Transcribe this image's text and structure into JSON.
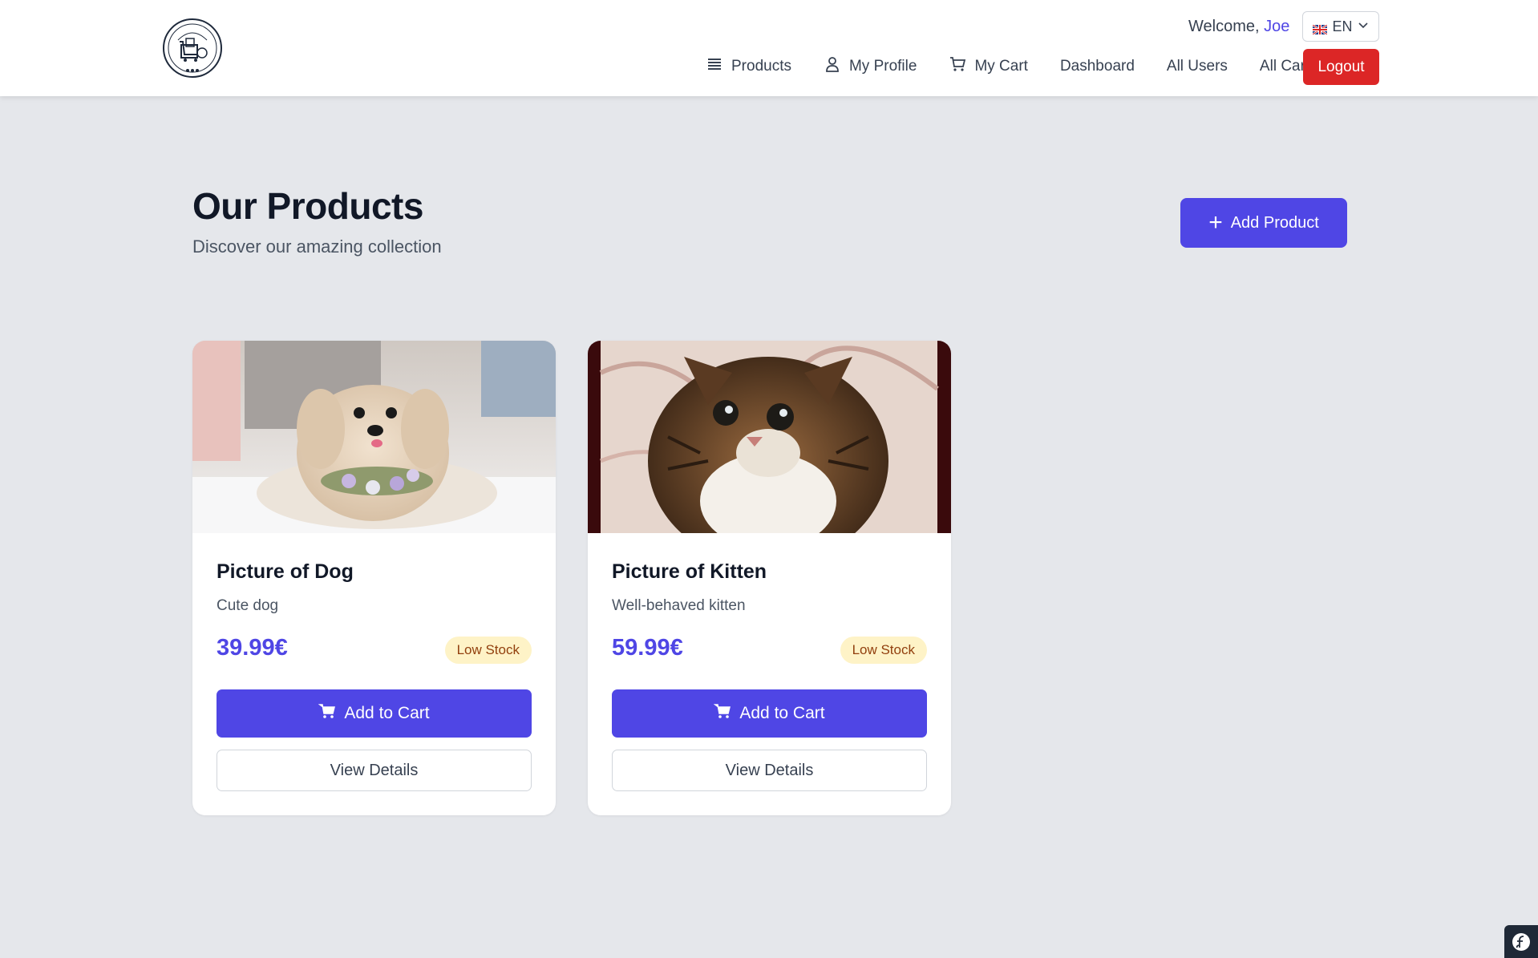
{
  "header": {
    "logo_alt": "Online Retail logo",
    "logo_text": "ONLINE RETAIL",
    "welcome_prefix": "Welcome, ",
    "user_name": "Joe",
    "language": "EN",
    "nav": [
      {
        "label": "Products",
        "icon": "list-icon"
      },
      {
        "label": "My Profile",
        "icon": "user-icon"
      },
      {
        "label": "My Cart",
        "icon": "cart-icon"
      },
      {
        "label": "Dashboard",
        "icon": ""
      },
      {
        "label": "All Users",
        "icon": ""
      },
      {
        "label": "All Carts",
        "icon": ""
      }
    ],
    "logout_label": "Logout"
  },
  "main": {
    "title": "Our Products",
    "subtitle": "Discover our amazing collection",
    "add_product_label": "Add Product"
  },
  "products": [
    {
      "name": "Picture of Dog",
      "description": "Cute dog",
      "price": "39.99€",
      "stock": "Low Stock",
      "image": "dog-photo",
      "add_to_cart_label": "Add to Cart",
      "view_details_label": "View Details"
    },
    {
      "name": "Picture of Kitten",
      "description": "Well-behaved kitten",
      "price": "59.99€",
      "stock": "Low Stock",
      "image": "kitten-photo",
      "add_to_cart_label": "Add to Cart",
      "view_details_label": "View Details"
    }
  ],
  "colors": {
    "primary": "#4f46e5",
    "danger": "#dc2626",
    "badge_bg": "#fef3c7",
    "badge_text": "#92400e",
    "page_bg": "#e5e7eb"
  }
}
